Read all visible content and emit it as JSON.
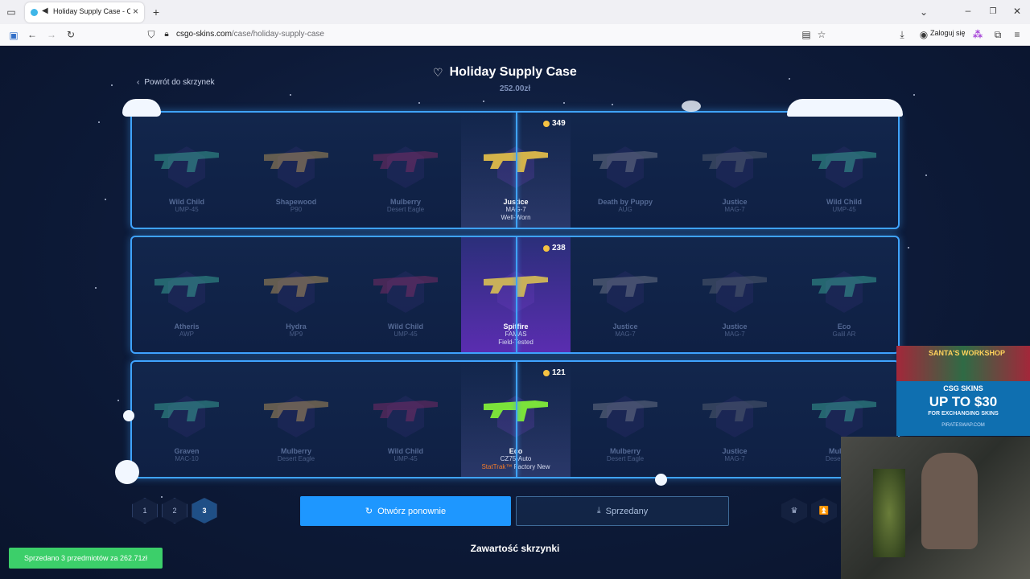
{
  "browser": {
    "tab_title": "Holiday Supply Case - CSGO",
    "url_domain": "csgo-skins.com",
    "url_path": "/case/holiday-supply-case",
    "login_label": "Zaloguj się"
  },
  "header": {
    "back_label": "Powrót do skrzynek",
    "title": "Holiday Supply Case",
    "price": "252.00zł"
  },
  "reels": [
    {
      "winner_price": "349",
      "items": [
        {
          "name": "Wild Child",
          "weapon": "UMP-45"
        },
        {
          "name": "Shapewood",
          "weapon": "P90"
        },
        {
          "name": "Mulberry",
          "weapon": "Desert Eagle"
        },
        {
          "name": "Justice",
          "weapon": "MAG-7",
          "wear": "Well-Worn"
        },
        {
          "name": "Death by Puppy",
          "weapon": "AUG"
        },
        {
          "name": "Justice",
          "weapon": "MAG-7"
        },
        {
          "name": "Wild Child",
          "weapon": "UMP-45"
        }
      ]
    },
    {
      "winner_price": "238",
      "items": [
        {
          "name": "Atheris",
          "weapon": "AWP"
        },
        {
          "name": "Hydra",
          "weapon": "MP9"
        },
        {
          "name": "Wild Child",
          "weapon": "UMP-45"
        },
        {
          "name": "Spitfire",
          "weapon": "FAMAS",
          "wear": "Field-Tested"
        },
        {
          "name": "Justice",
          "weapon": "MAG-7"
        },
        {
          "name": "Justice",
          "weapon": "MAG-7"
        },
        {
          "name": "Eco",
          "weapon": "Galil AR"
        }
      ]
    },
    {
      "winner_price": "121",
      "items": [
        {
          "name": "Graven",
          "weapon": "MAC-10"
        },
        {
          "name": "Mulberry",
          "weapon": "Desert Eagle"
        },
        {
          "name": "Wild Child",
          "weapon": "UMP-45"
        },
        {
          "name": "Eco",
          "weapon": "CZ75-Auto",
          "stattrak": "StatTrak™",
          "wear": "Factory New"
        },
        {
          "name": "Mulberry",
          "weapon": "Desert Eagle"
        },
        {
          "name": "Justice",
          "weapon": "MAG-7"
        },
        {
          "name": "Mulberry",
          "weapon": "Desert Eagle"
        }
      ]
    }
  ],
  "pager": [
    "1",
    "2",
    "3"
  ],
  "actions": {
    "open_again": "Otwórz ponownie",
    "sold": "Sprzedany"
  },
  "contents_title": "Zawartość skrzynki",
  "toast": "Sprzedano 3 przedmiotów za 262.71zł",
  "ad": {
    "banner": "SANTA'S WORKSHOP",
    "brand": "CSG SKINS",
    "headline": "UP TO $30",
    "sub": "FOR EXCHANGING SKINS",
    "url": "PIRATESWAP.COM"
  },
  "colors": {
    "accent": "#1e97ff",
    "reel_border": "#3fa3ff",
    "toast": "#3ccf6a",
    "stattrak": "#f07a2a",
    "coin": "#f5c242"
  }
}
